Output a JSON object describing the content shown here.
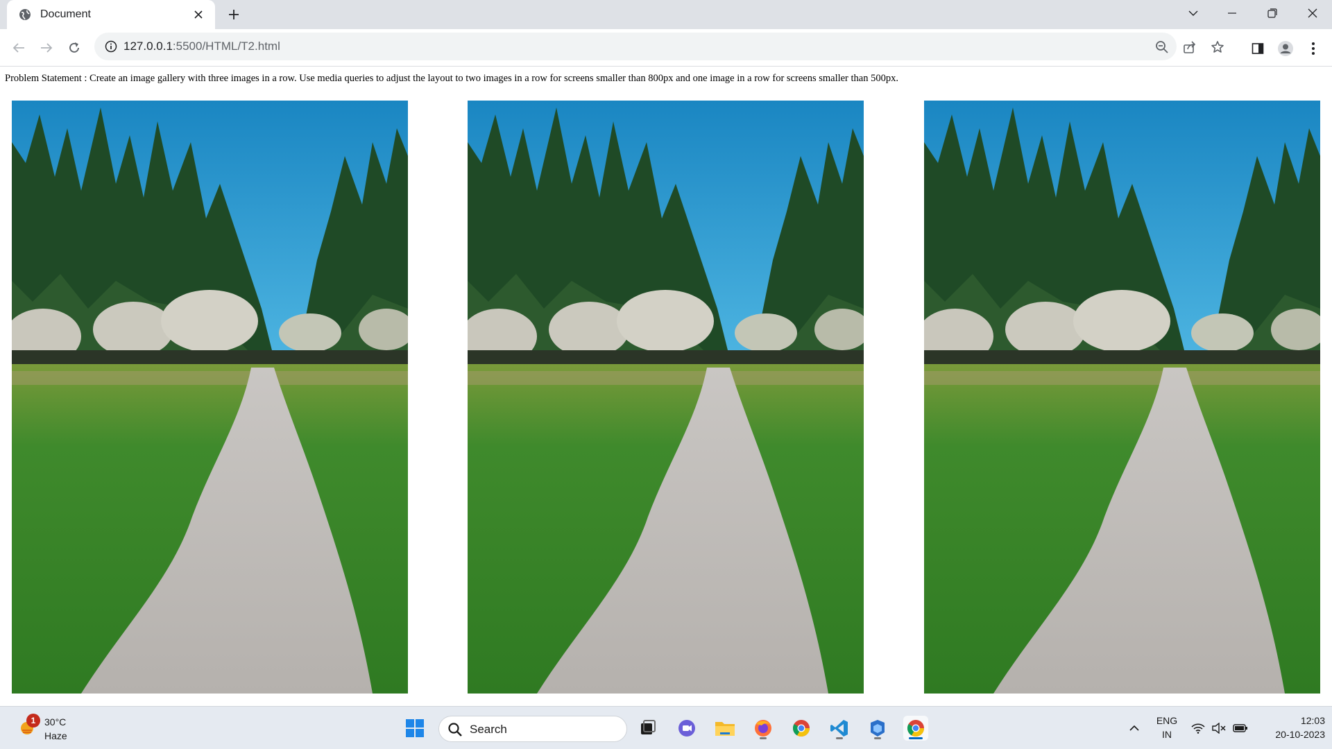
{
  "browser": {
    "tab_title": "Document",
    "url_host": "127.0.0.1",
    "url_path": ":5500/HTML/T2.html",
    "icons": [
      "globe-icon",
      "close-icon",
      "plus-icon",
      "chevron-down-icon",
      "minimize-icon",
      "restore-icon",
      "window-close-icon",
      "back-arrow-icon",
      "forward-arrow-icon",
      "reload-icon",
      "info-icon",
      "zoom-out-icon",
      "share-icon",
      "star-icon",
      "side-panel-icon",
      "profile-icon",
      "more-vertical-icon"
    ]
  },
  "page": {
    "problem_statement": "Problem Statement : Create an image gallery with three images in a row. Use media queries to adjust the layout to two images in a row for screens smaller than 800px and one image in a row for screens smaller than 500px.",
    "gallery": [
      "path-through-trees-image",
      "path-through-trees-image",
      "path-through-trees-image"
    ]
  },
  "taskbar": {
    "weather": {
      "badge": "1",
      "temperature": "30°C",
      "condition": "Haze"
    },
    "search_placeholder": "Search",
    "apps": [
      "windows-start-icon",
      "task-view-icon",
      "teams-chat-icon",
      "file-explorer-icon",
      "firefox-icon",
      "chrome-icon",
      "vscode-icon",
      "app-icon",
      "chrome-active-icon"
    ],
    "language_line1": "ENG",
    "language_line2": "IN",
    "time": "12:03",
    "date": "20-10-2023"
  },
  "colors": {
    "chrome_bg": "#dee1e6",
    "omnibox_bg": "#f1f3f4",
    "taskbar_bg": "#e5eaf1",
    "accent": "#0067c0"
  }
}
